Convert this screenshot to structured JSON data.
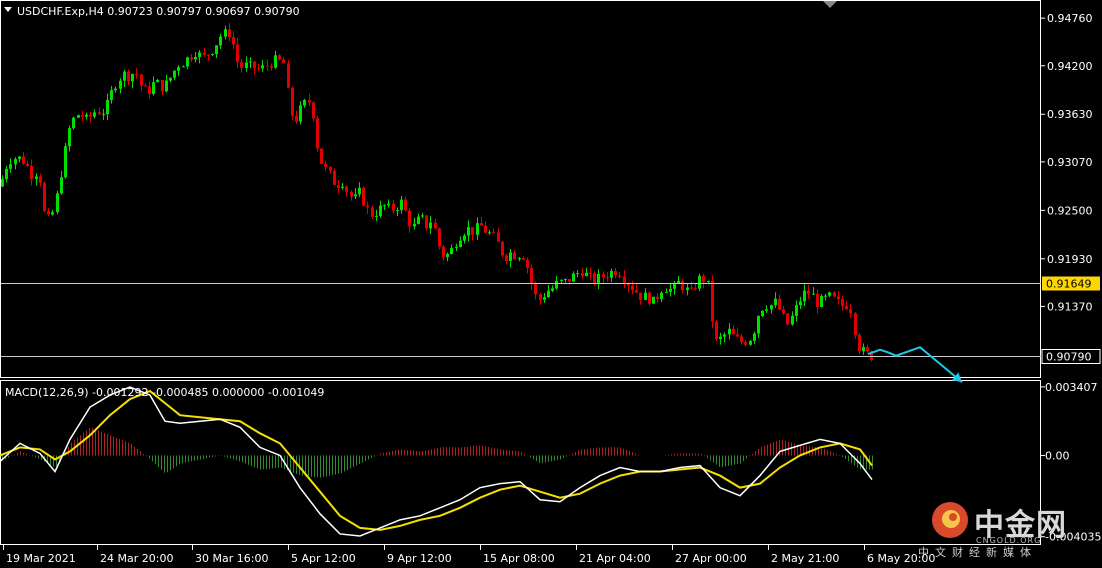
{
  "chart_data": {
    "type": "candlestick",
    "title": "USDCHF.Exp,H4  0.90723 0.90797 0.90697 0.90790",
    "price_axis": {
      "min": 0.9054,
      "max": 0.9495,
      "ticks": [
        "0.94760",
        "0.94200",
        "0.93630",
        "0.93070",
        "0.92500",
        "0.91930",
        "0.91370"
      ]
    },
    "x_ticks": [
      "19 Mar 2021",
      "24 Mar 20:00",
      "30 Mar 16:00",
      "5 Apr 12:00",
      "9 Apr 12:00",
      "15 Apr 08:00",
      "21 Apr 04:00",
      "27 Apr 00:00",
      "2 May 21:00",
      "6 May 20:00"
    ],
    "price_path": [
      [
        0,
        0.9278
      ],
      [
        5,
        0.93
      ],
      [
        10,
        0.931
      ],
      [
        16,
        0.9312
      ],
      [
        22,
        0.931
      ],
      [
        28,
        0.93
      ],
      [
        33,
        0.929
      ],
      [
        38,
        0.93
      ],
      [
        42,
        0.927
      ],
      [
        45,
        0.9235
      ],
      [
        50,
        0.924
      ],
      [
        55,
        0.9255
      ],
      [
        60,
        0.929
      ],
      [
        65,
        0.932
      ],
      [
        70,
        0.935
      ],
      [
        75,
        0.936
      ],
      [
        80,
        0.9365
      ],
      [
        85,
        0.9355
      ],
      [
        90,
        0.936
      ],
      [
        96,
        0.9368
      ],
      [
        102,
        0.9365
      ],
      [
        108,
        0.9375
      ],
      [
        113,
        0.9395
      ],
      [
        118,
        0.9405
      ],
      [
        124,
        0.941
      ],
      [
        130,
        0.9408
      ],
      [
        135,
        0.9415
      ],
      [
        140,
        0.9398
      ],
      [
        145,
        0.939
      ],
      [
        150,
        0.9392
      ],
      [
        155,
        0.9402
      ],
      [
        160,
        0.9395
      ],
      [
        166,
        0.9398
      ],
      [
        172,
        0.941
      ],
      [
        178,
        0.9422
      ],
      [
        184,
        0.9425
      ],
      [
        190,
        0.9432
      ],
      [
        196,
        0.9438
      ],
      [
        202,
        0.9428
      ],
      [
        208,
        0.9435
      ],
      [
        214,
        0.9442
      ],
      [
        220,
        0.9455
      ],
      [
        226,
        0.9458
      ],
      [
        231,
        0.946
      ],
      [
        235,
        0.943
      ],
      [
        240,
        0.9418
      ],
      [
        245,
        0.942
      ],
      [
        250,
        0.9418
      ],
      [
        255,
        0.9418
      ],
      [
        260,
        0.9415
      ],
      [
        266,
        0.942
      ],
      [
        272,
        0.9425
      ],
      [
        278,
        0.9426
      ],
      [
        284,
        0.9422
      ],
      [
        290,
        0.9365
      ],
      [
        296,
        0.9358
      ],
      [
        302,
        0.9372
      ],
      [
        308,
        0.938
      ],
      [
        314,
        0.936
      ],
      [
        318,
        0.9315
      ],
      [
        324,
        0.93
      ],
      [
        330,
        0.929
      ],
      [
        336,
        0.928
      ],
      [
        342,
        0.9285
      ],
      [
        348,
        0.927
      ],
      [
        354,
        0.9262
      ],
      [
        360,
        0.9272
      ],
      [
        366,
        0.9252
      ],
      [
        372,
        0.9245
      ],
      [
        378,
        0.925
      ],
      [
        384,
        0.9255
      ],
      [
        390,
        0.925
      ],
      [
        396,
        0.9255
      ],
      [
        402,
        0.926
      ],
      [
        408,
        0.9238
      ],
      [
        414,
        0.923
      ],
      [
        420,
        0.9242
      ],
      [
        426,
        0.9232
      ],
      [
        432,
        0.924
      ],
      [
        438,
        0.921
      ],
      [
        444,
        0.9195
      ],
      [
        450,
        0.92
      ],
      [
        456,
        0.9215
      ],
      [
        462,
        0.9225
      ],
      [
        468,
        0.9228
      ],
      [
        474,
        0.9225
      ],
      [
        480,
        0.9232
      ],
      [
        486,
        0.9225
      ],
      [
        492,
        0.922
      ],
      [
        498,
        0.921
      ],
      [
        504,
        0.9195
      ],
      [
        510,
        0.92
      ],
      [
        516,
        0.9198
      ],
      [
        522,
        0.92
      ],
      [
        528,
        0.918
      ],
      [
        534,
        0.915
      ],
      [
        540,
        0.9145
      ],
      [
        546,
        0.9155
      ],
      [
        552,
        0.9158
      ],
      [
        558,
        0.9165
      ],
      [
        564,
        0.9165
      ],
      [
        570,
        0.917
      ],
      [
        576,
        0.9175
      ],
      [
        582,
        0.918
      ],
      [
        588,
        0.917
      ],
      [
        594,
        0.9168
      ],
      [
        600,
        0.917
      ],
      [
        606,
        0.9175
      ],
      [
        612,
        0.9178
      ],
      [
        618,
        0.918
      ],
      [
        624,
        0.917
      ],
      [
        630,
        0.9162
      ],
      [
        636,
        0.9155
      ],
      [
        642,
        0.9148
      ],
      [
        648,
        0.9148
      ],
      [
        654,
        0.914
      ],
      [
        660,
        0.9158
      ],
      [
        666,
        0.916
      ],
      [
        672,
        0.9155
      ],
      [
        678,
        0.9165
      ],
      [
        684,
        0.916
      ],
      [
        690,
        0.915
      ],
      [
        696,
        0.9165
      ],
      [
        702,
        0.9172
      ],
      [
        708,
        0.916
      ],
      [
        712,
        0.912
      ],
      [
        716,
        0.9095
      ],
      [
        722,
        0.91
      ],
      [
        728,
        0.9108
      ],
      [
        734,
        0.91
      ],
      [
        740,
        0.9095
      ],
      [
        746,
        0.9097
      ],
      [
        752,
        0.9102
      ],
      [
        758,
        0.9128
      ],
      [
        764,
        0.914
      ],
      [
        770,
        0.9138
      ],
      [
        776,
        0.9142
      ],
      [
        782,
        0.9125
      ],
      [
        788,
        0.9115
      ],
      [
        794,
        0.913
      ],
      [
        800,
        0.9145
      ],
      [
        806,
        0.9155
      ],
      [
        812,
        0.915
      ],
      [
        818,
        0.914
      ],
      [
        824,
        0.9145
      ],
      [
        830,
        0.9148
      ],
      [
        836,
        0.9142
      ],
      [
        842,
        0.9138
      ],
      [
        848,
        0.914
      ],
      [
        852,
        0.913
      ],
      [
        856,
        0.91
      ],
      [
        860,
        0.9085
      ],
      [
        864,
        0.9083
      ],
      [
        868,
        0.908
      ],
      [
        872,
        0.9079
      ]
    ],
    "horizontal_lines": [
      {
        "value": 0.91649,
        "label": "0.91649",
        "color": "#ffd700"
      },
      {
        "value": 0.9079,
        "label": "0.90790",
        "color": "#c8c8c8"
      }
    ],
    "forecast_arrow": {
      "color": "#1ec8e6",
      "points": [
        [
          868,
          0.9081
        ],
        [
          880,
          0.9086
        ],
        [
          888,
          0.9083
        ],
        [
          896,
          0.9079
        ],
        [
          920,
          0.9089
        ],
        [
          962,
          0.9048
        ]
      ]
    },
    "macd": {
      "title": "MACD(12,26,9) -0.001292 -0.000485 0.000000 -0.001049",
      "ticks": [
        "0.003407",
        "0.00",
        "-0.004035"
      ],
      "min": -0.0043,
      "max": 0.0036,
      "main_line_color": "#ffffff",
      "signal_line_color": "#f5e000",
      "histogram_pos_color": "#b22222",
      "histogram_neg_color": "#2e8b2e",
      "main_path": [
        [
          0,
          -0.0003
        ],
        [
          20,
          0.0006
        ],
        [
          40,
          0.0001
        ],
        [
          55,
          -0.0008
        ],
        [
          70,
          0.0008
        ],
        [
          90,
          0.0024
        ],
        [
          110,
          0.003
        ],
        [
          130,
          0.0034
        ],
        [
          150,
          0.003
        ],
        [
          165,
          0.0017
        ],
        [
          180,
          0.0016
        ],
        [
          200,
          0.0017
        ],
        [
          220,
          0.0018
        ],
        [
          240,
          0.0014
        ],
        [
          260,
          0.0004
        ],
        [
          280,
          0.0
        ],
        [
          300,
          -0.0016
        ],
        [
          320,
          -0.0029
        ],
        [
          340,
          -0.0039
        ],
        [
          360,
          -0.004
        ],
        [
          380,
          -0.0036
        ],
        [
          400,
          -0.0032
        ],
        [
          420,
          -0.003
        ],
        [
          440,
          -0.0026
        ],
        [
          460,
          -0.0022
        ],
        [
          480,
          -0.0016
        ],
        [
          500,
          -0.0014
        ],
        [
          520,
          -0.0013
        ],
        [
          540,
          -0.0022
        ],
        [
          560,
          -0.0023
        ],
        [
          580,
          -0.0016
        ],
        [
          600,
          -0.001
        ],
        [
          620,
          -0.0006
        ],
        [
          640,
          -0.0008
        ],
        [
          660,
          -0.0008
        ],
        [
          680,
          -0.0006
        ],
        [
          700,
          -0.0005
        ],
        [
          720,
          -0.0016
        ],
        [
          740,
          -0.002
        ],
        [
          760,
          -0.001
        ],
        [
          780,
          0.0002
        ],
        [
          800,
          0.0005
        ],
        [
          820,
          0.0008
        ],
        [
          840,
          0.0006
        ],
        [
          860,
          -0.0004
        ],
        [
          872,
          -0.0012
        ]
      ],
      "signal_path": [
        [
          0,
          0.0
        ],
        [
          20,
          0.0004
        ],
        [
          40,
          0.0003
        ],
        [
          55,
          -0.0002
        ],
        [
          70,
          0.0002
        ],
        [
          90,
          0.001
        ],
        [
          110,
          0.002
        ],
        [
          130,
          0.0028
        ],
        [
          150,
          0.0032
        ],
        [
          165,
          0.0026
        ],
        [
          180,
          0.002
        ],
        [
          200,
          0.0019
        ],
        [
          220,
          0.0018
        ],
        [
          240,
          0.0017
        ],
        [
          260,
          0.0011
        ],
        [
          280,
          0.0006
        ],
        [
          300,
          -0.0006
        ],
        [
          320,
          -0.0018
        ],
        [
          340,
          -0.003
        ],
        [
          360,
          -0.0036
        ],
        [
          380,
          -0.0037
        ],
        [
          400,
          -0.0035
        ],
        [
          420,
          -0.0032
        ],
        [
          440,
          -0.003
        ],
        [
          460,
          -0.0026
        ],
        [
          480,
          -0.0021
        ],
        [
          500,
          -0.0017
        ],
        [
          520,
          -0.0015
        ],
        [
          540,
          -0.0018
        ],
        [
          560,
          -0.0021
        ],
        [
          580,
          -0.0019
        ],
        [
          600,
          -0.0014
        ],
        [
          620,
          -0.001
        ],
        [
          640,
          -0.0008
        ],
        [
          660,
          -0.0008
        ],
        [
          680,
          -0.0007
        ],
        [
          700,
          -0.0006
        ],
        [
          720,
          -0.001
        ],
        [
          740,
          -0.0016
        ],
        [
          760,
          -0.0014
        ],
        [
          780,
          -0.0006
        ],
        [
          800,
          0.0
        ],
        [
          820,
          0.0004
        ],
        [
          840,
          0.0006
        ],
        [
          860,
          0.0003
        ],
        [
          872,
          -0.0005
        ]
      ]
    }
  },
  "logo": {
    "main_text": "中金网",
    "url_text": "CNGOLD.ORG",
    "sub_text": "中文财经新媒体"
  }
}
